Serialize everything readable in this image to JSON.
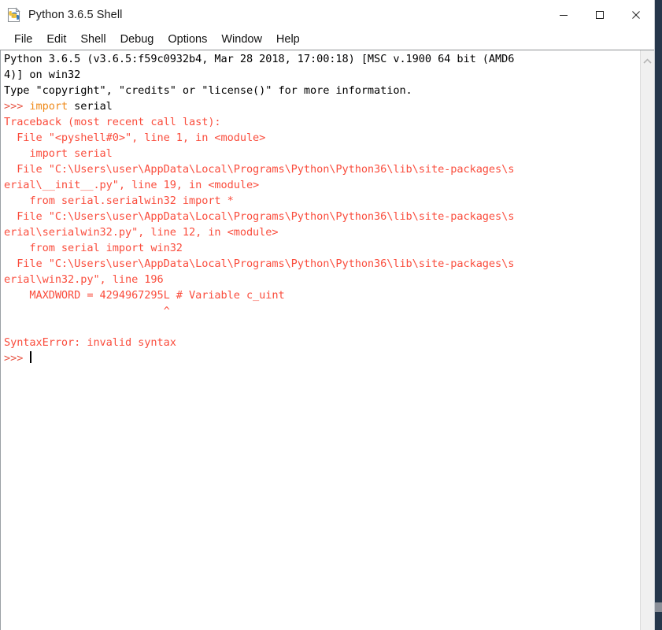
{
  "window": {
    "title": "Python 3.6.5 Shell",
    "icon": "python-file-icon",
    "controls": [
      {
        "name": "minimize-button",
        "glyph": "minimize-icon",
        "label": "Minimize"
      },
      {
        "name": "maximize-button",
        "glyph": "maximize-icon",
        "label": "Maximize"
      },
      {
        "name": "close-button",
        "glyph": "close-icon",
        "label": "Close"
      }
    ]
  },
  "menu": {
    "items": [
      {
        "label": "File"
      },
      {
        "label": "Edit"
      },
      {
        "label": "Shell"
      },
      {
        "label": "Debug"
      },
      {
        "label": "Options"
      },
      {
        "label": "Window"
      },
      {
        "label": "Help"
      }
    ]
  },
  "console": {
    "scrollbar": {
      "arrow_icon": "chevron-up-icon"
    },
    "cursor": {
      "visible": true,
      "column": 4
    },
    "colors": {
      "prompt": "#e85a4a",
      "keyword": "#ef8b1c",
      "error": "#fa4d3d",
      "text": "#000000",
      "background": "#ffffff"
    },
    "lines": [
      {
        "segments": [
          {
            "text": "Python 3.6.5 (v3.6.5:f59c0932b4, Mar 28 2018, 17:00:18) [MSC v.1900 64 bit (AMD6",
            "style": "plain"
          }
        ]
      },
      {
        "segments": [
          {
            "text": "4)] on win32",
            "style": "plain"
          }
        ]
      },
      {
        "segments": [
          {
            "text": "Type \"copyright\", \"credits\" or \"license()\" for more information.",
            "style": "plain"
          }
        ]
      },
      {
        "segments": [
          {
            "text": ">>> ",
            "style": "prompt"
          },
          {
            "text": "import",
            "style": "keyword"
          },
          {
            "text": " serial",
            "style": "plain"
          }
        ]
      },
      {
        "segments": [
          {
            "text": "Traceback (most recent call last):",
            "style": "error"
          }
        ]
      },
      {
        "segments": [
          {
            "text": "  File \"<pyshell#0>\", line 1, in <module>",
            "style": "error"
          }
        ]
      },
      {
        "segments": [
          {
            "text": "    import serial",
            "style": "error"
          }
        ]
      },
      {
        "segments": [
          {
            "text": "  File \"C:\\Users\\user\\AppData\\Local\\Programs\\Python\\Python36\\lib\\site-packages\\s",
            "style": "error"
          }
        ]
      },
      {
        "segments": [
          {
            "text": "erial\\__init__.py\", line 19, in <module>",
            "style": "error"
          }
        ]
      },
      {
        "segments": [
          {
            "text": "    from serial.serialwin32 import *",
            "style": "error"
          }
        ]
      },
      {
        "segments": [
          {
            "text": "  File \"C:\\Users\\user\\AppData\\Local\\Programs\\Python\\Python36\\lib\\site-packages\\s",
            "style": "error"
          }
        ]
      },
      {
        "segments": [
          {
            "text": "erial\\serialwin32.py\", line 12, in <module>",
            "style": "error"
          }
        ]
      },
      {
        "segments": [
          {
            "text": "    from serial import win32",
            "style": "error"
          }
        ]
      },
      {
        "segments": [
          {
            "text": "  File \"C:\\Users\\user\\AppData\\Local\\Programs\\Python\\Python36\\lib\\site-packages\\s",
            "style": "error"
          }
        ]
      },
      {
        "segments": [
          {
            "text": "erial\\win32.py\", line 196",
            "style": "error"
          }
        ]
      },
      {
        "segments": [
          {
            "text": "    MAXDWORD = 4294967295L # Variable c_uint",
            "style": "error"
          }
        ]
      },
      {
        "segments": [
          {
            "text": "                         ^",
            "style": "error"
          }
        ]
      },
      {
        "segments": [
          {
            "text": "",
            "style": "error"
          }
        ]
      },
      {
        "segments": [
          {
            "text": "SyntaxError: invalid syntax",
            "style": "error"
          }
        ]
      },
      {
        "segments": [
          {
            "text": ">>> ",
            "style": "prompt"
          },
          {
            "text": "",
            "style": "cursor"
          }
        ]
      }
    ]
  }
}
